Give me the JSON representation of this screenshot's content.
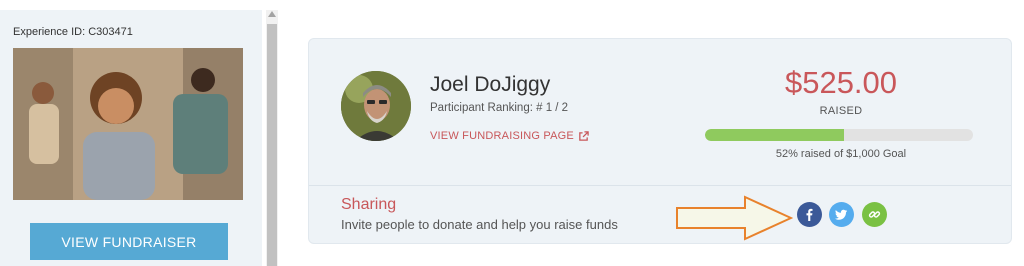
{
  "sidebar": {
    "experience_id": "Experience ID: C303471",
    "view_button": "VIEW FUNDRAISER"
  },
  "participant": {
    "name": "Joel DoJiggy",
    "ranking": "Participant Ranking: # 1 / 2",
    "fundraising_link": "VIEW FUNDRAISING PAGE"
  },
  "fundraising": {
    "amount": "$525.00",
    "raised_label": "RAISED",
    "progress_percent": 52,
    "goal_text": "52% raised of $1,000 Goal"
  },
  "sharing": {
    "title": "Sharing",
    "description": "Invite people to donate and help you raise funds",
    "buttons": [
      {
        "icon": "facebook-icon",
        "color": "#3b5998"
      },
      {
        "icon": "twitter-icon",
        "color": "#55acee"
      },
      {
        "icon": "link-icon",
        "color": "#7ac143"
      }
    ]
  },
  "colors": {
    "accent_red": "#c9575a",
    "button_blue": "#56a9d4",
    "progress_green": "#8fca5e",
    "arrow_orange": "#e8822c"
  }
}
